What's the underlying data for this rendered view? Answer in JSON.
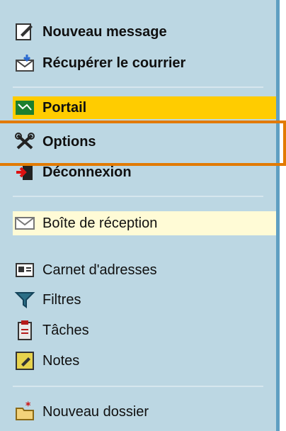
{
  "menu": {
    "new_message": "Nouveau message",
    "fetch_mail": "Récupérer le courrier",
    "portal": "Portail",
    "options": "Options",
    "logout": "Déconnexion",
    "inbox": "Boîte de réception",
    "address_book": "Carnet d'adresses",
    "filters": "Filtres",
    "tasks": "Tâches",
    "notes": "Notes",
    "new_folder": "Nouveau dossier"
  },
  "colors": {
    "panel_bg": "#bcd7e3",
    "selected_bg": "#ffcc00",
    "inbox_bg": "#fffbd6",
    "highlight_border": "#e27a00"
  }
}
